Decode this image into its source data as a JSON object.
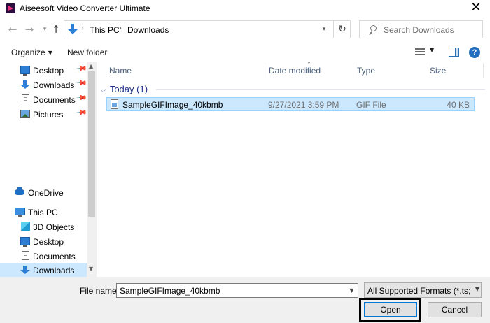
{
  "window": {
    "title": "Aiseesoft Video Converter Ultimate"
  },
  "addressbar": {
    "crumbs": [
      "This PC",
      "Downloads"
    ]
  },
  "search": {
    "placeholder": "Search Downloads"
  },
  "toolbar": {
    "organize": "Organize",
    "new_folder": "New folder"
  },
  "navpane": {
    "quick_access": [
      {
        "label": "Desktop",
        "icon": "desktop-icon",
        "pinned": true
      },
      {
        "label": "Downloads",
        "icon": "download-icon",
        "pinned": true
      },
      {
        "label": "Documents",
        "icon": "documents-icon",
        "pinned": true
      },
      {
        "label": "Pictures",
        "icon": "pictures-icon",
        "pinned": true
      }
    ],
    "onedrive": "OneDrive",
    "this_pc": "This PC",
    "this_pc_items": [
      {
        "label": "3D Objects",
        "icon": "3d-objects-icon"
      },
      {
        "label": "Desktop",
        "icon": "desktop-icon"
      },
      {
        "label": "Documents",
        "icon": "documents-icon"
      },
      {
        "label": "Downloads",
        "icon": "download-icon",
        "selected": true
      }
    ]
  },
  "filelist": {
    "columns": {
      "name": "Name",
      "date": "Date modified",
      "type": "Type",
      "size": "Size"
    },
    "group": "Today (1)",
    "files": [
      {
        "name": "SampleGIFImage_40kbmb",
        "date": "9/27/2021 3:59 PM",
        "type": "GIF File",
        "size": "40 KB"
      }
    ]
  },
  "footer": {
    "file_name_label": "File name:",
    "file_name_value": "SampleGIFImage_40kbmb",
    "filter": "All Supported Formats (*.ts;*.m",
    "open_label": "Open",
    "cancel_label": "Cancel"
  },
  "colors": {
    "selection": "#cce8ff",
    "accent": "#0078d7",
    "group_header": "#1e3287"
  }
}
